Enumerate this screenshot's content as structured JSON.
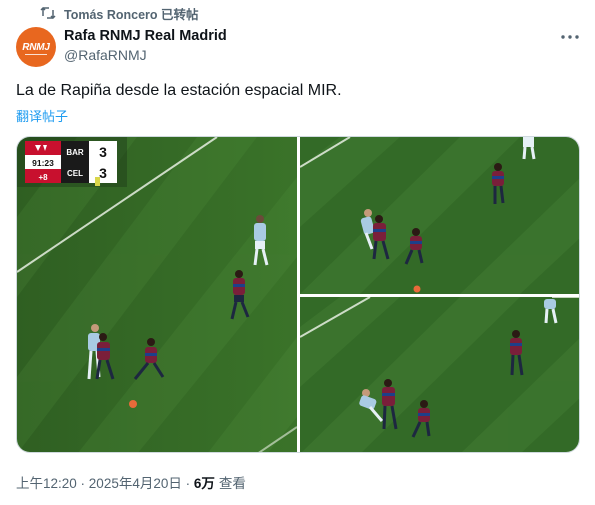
{
  "retweet": {
    "label": "Tomás Roncero 已转帖",
    "icon": "retweet-icon"
  },
  "author": {
    "avatar_text": "RNMJ",
    "avatar_color": "#e8671f",
    "display_name": "Rafa RNMJ Real Madrid",
    "handle": "@RafaRNMJ"
  },
  "more_icon": "more-icon",
  "tweet": {
    "text": "La de Rapiña desde la estación espacial MIR.",
    "translate_label": "翻译帖子"
  },
  "media": {
    "scorebug": {
      "home_team": "BAR",
      "away_team": "CEL",
      "home_score": "3",
      "away_score": "3",
      "clock": "91:23",
      "added_time": "+8"
    },
    "colors": {
      "pitch_dark": "#2f5f22",
      "pitch_light": "#3d7a2c",
      "barca": "#7a1f3a",
      "celta": "#a9cbe3"
    }
  },
  "footer": {
    "time": "上午12:20",
    "separator": " · ",
    "date": "2025年4月20日",
    "separator2": " · ",
    "views": "6万",
    "views_label": "查看"
  },
  "accent": "#1d9bf0"
}
